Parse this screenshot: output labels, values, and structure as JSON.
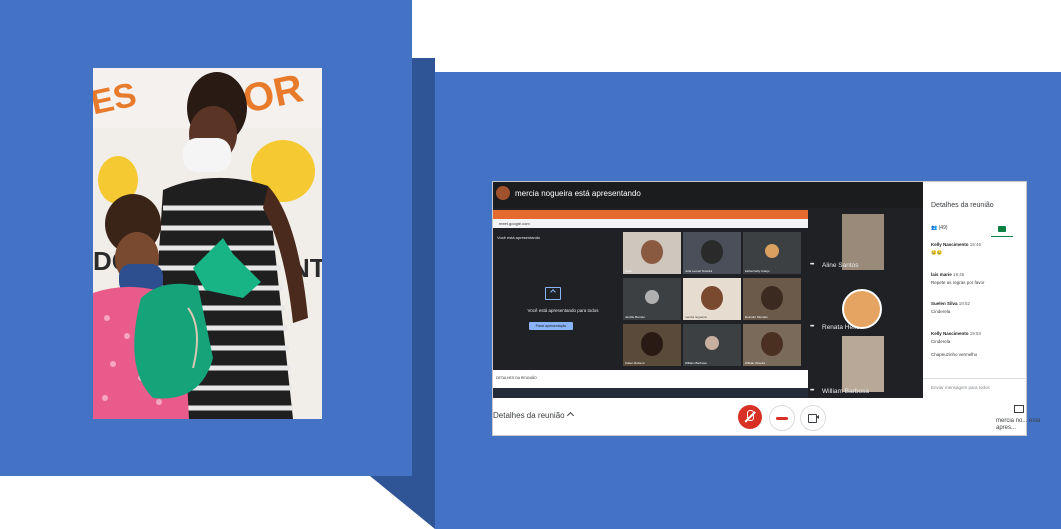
{
  "screen": {
    "presenter_label": "mercia nogueira está apresentando",
    "inner": {
      "url": "meet.google.com",
      "you_presenting": "Você está apresentando",
      "presenting_to_all": "Você está apresentando para todos",
      "stop_presenting": "Parar apresentação",
      "taskbar_text": "DETALHES DA REUNIÃO",
      "tiles": [
        {
          "name": "Você"
        },
        {
          "name": "Julia Leonel Teixeira"
        },
        {
          "name": "katherinelly Araujo"
        },
        {
          "name": "Jamille Barreto"
        },
        {
          "name": "mercia nogueira"
        },
        {
          "name": "Evandro Mendes"
        },
        {
          "name": "Kellen Rebeca"
        },
        {
          "name": "William Barbosa"
        },
        {
          "name": "Wilhan Oliveira"
        }
      ]
    },
    "right_tiles": [
      {
        "name": "Aline Santos"
      },
      {
        "name": "Renata Hellen"
      },
      {
        "name": "William Barbosa"
      }
    ],
    "sidebar": {
      "title": "Detalhes da reunião",
      "people_count": "(49)",
      "messages": [
        {
          "sender": "Kelly Nascimento",
          "time": "19:46",
          "lines": [
            "😢😢"
          ]
        },
        {
          "sender": "lais marie",
          "time": "19:46",
          "lines": [
            "Repete as regras por favor"
          ]
        },
        {
          "sender": "Suelen Silva",
          "time": "19:52",
          "lines": [
            "Cinderela"
          ]
        },
        {
          "sender": "Kelly Nascimento",
          "time": "19:53",
          "lines": [
            "Cinderela",
            "Chapeuzinho vermelho"
          ]
        }
      ],
      "input_placeholder": "Enviar mensagem para todos"
    },
    "bottom": {
      "details": "Detalhes da reunião",
      "presenting_note": "mercia no... está apres..."
    }
  },
  "photo": {
    "wall_text_left": "ES",
    "wall_text_right": "OR",
    "board_text_1": "DO",
    "board_text_2": "NT"
  },
  "colors": {
    "panel": "#4472c4",
    "panel_shadow": "#2f5597",
    "meet_dark": "#202124",
    "mic_red": "#d93025"
  }
}
